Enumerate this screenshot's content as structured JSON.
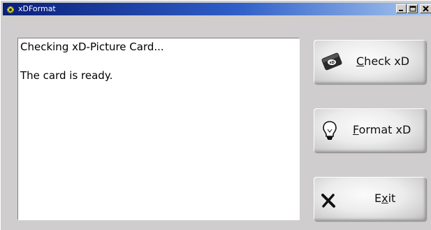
{
  "window": {
    "title": "xDFormat"
  },
  "messages": [
    "Checking xD-Picture Card...",
    "The card is ready."
  ],
  "buttons": {
    "check": {
      "mnemonic": "C",
      "rest": "heck xD"
    },
    "format": {
      "mnemonic": "F",
      "rest": "ormat xD"
    },
    "exit": {
      "pre": "E",
      "mnemonic": "x",
      "rest": "it"
    }
  },
  "icons": {
    "app": "xd-app-icon",
    "check": "xd-card-icon",
    "format": "lightbulb-icon",
    "exit": "x-mark-icon"
  },
  "colors": {
    "titlebar_start": "#0a1f7a",
    "titlebar_end": "#a9c8f0",
    "window_bg": "#cfcdcd",
    "panel_bg": "#ffffff"
  }
}
